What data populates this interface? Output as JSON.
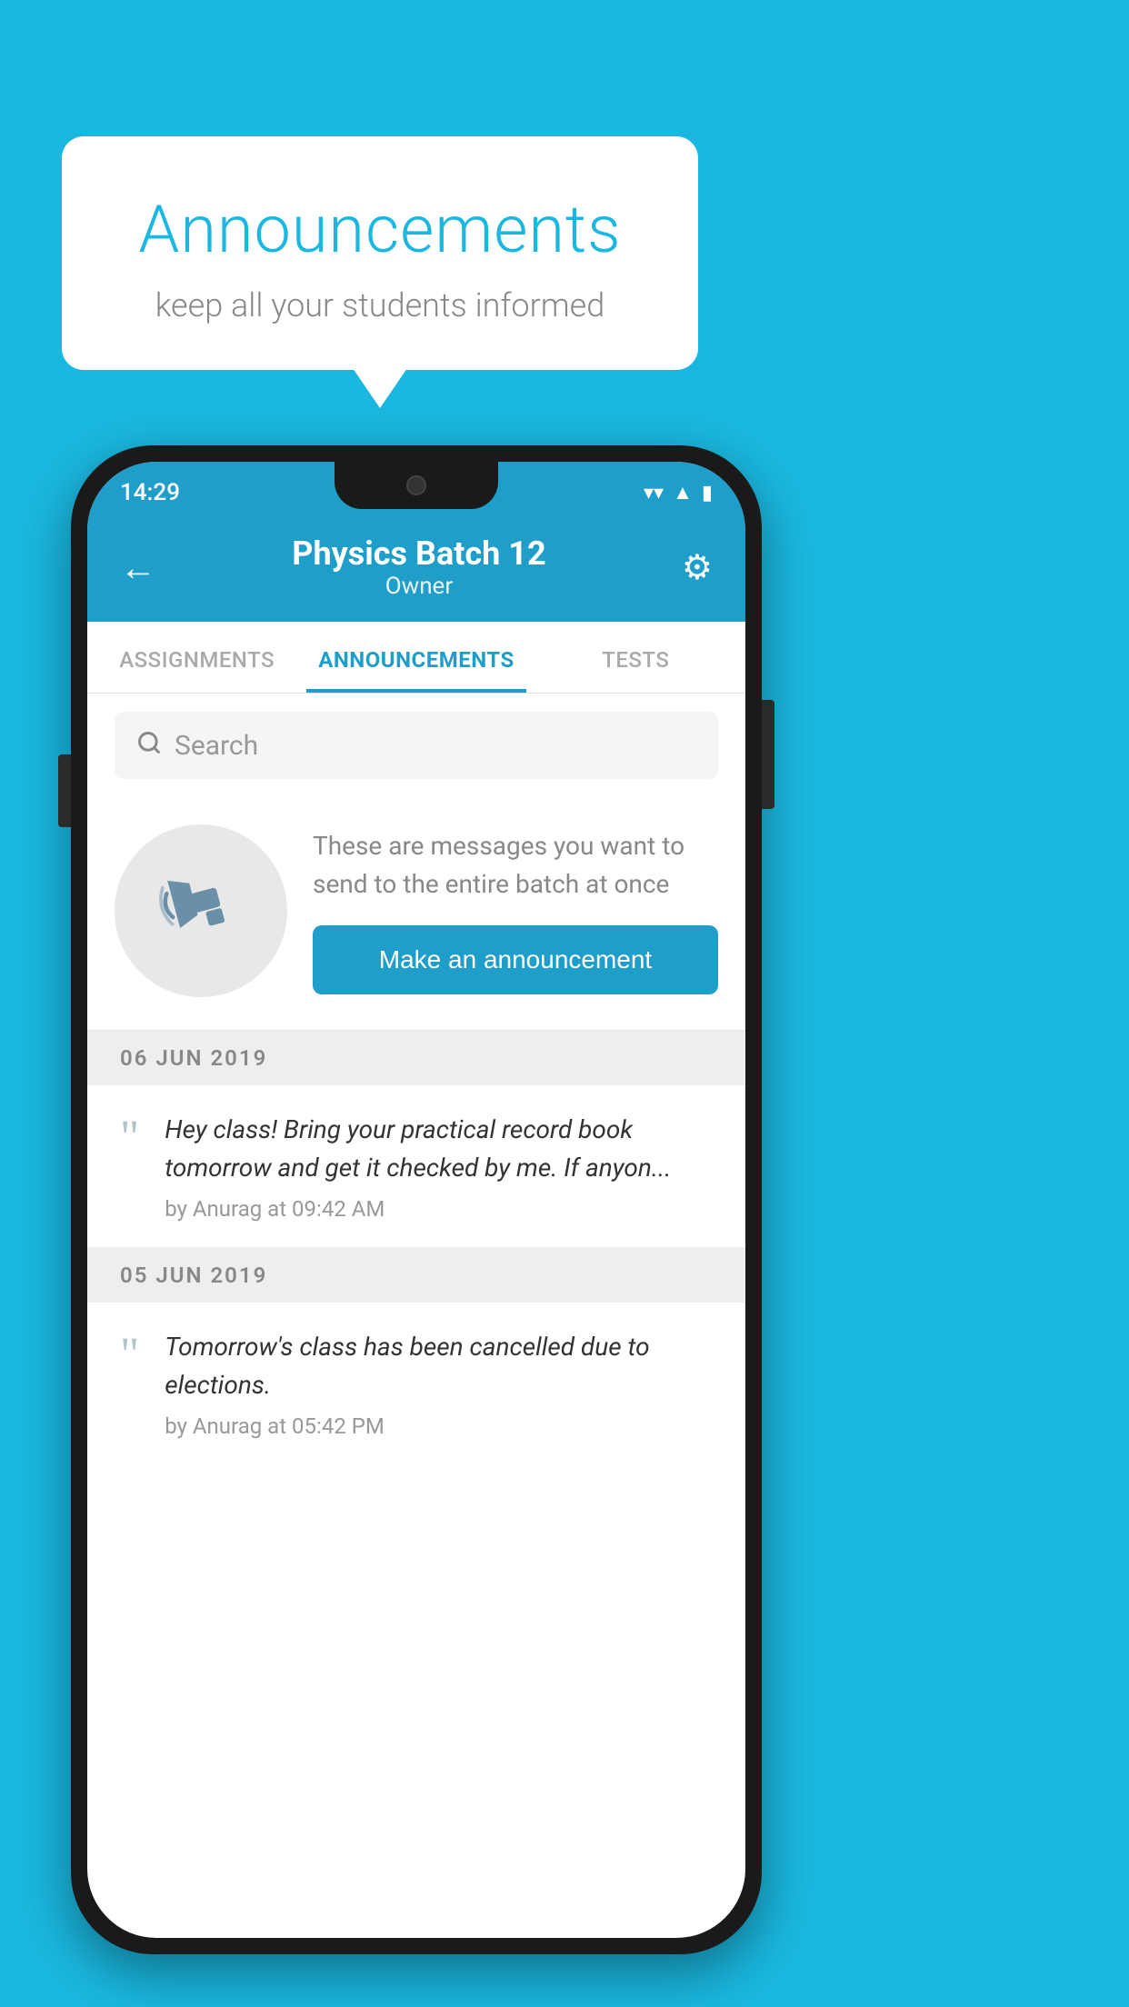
{
  "header": {
    "background_color": "#1ab8e0",
    "speech_bubble": {
      "title": "Announcements",
      "subtitle": "keep all your students informed"
    }
  },
  "phone": {
    "status_bar": {
      "time": "14:29",
      "wifi": "▼",
      "signal": "▲",
      "battery": "▮"
    },
    "app_header": {
      "back_icon": "←",
      "title": "Physics Batch 12",
      "subtitle": "Owner",
      "settings_icon": "⚙"
    },
    "tabs": [
      {
        "label": "ASSIGNMENTS",
        "active": false
      },
      {
        "label": "ANNOUNCEMENTS",
        "active": true
      },
      {
        "label": "TESTS",
        "active": false
      },
      {
        "label": "...",
        "active": false
      }
    ],
    "search": {
      "placeholder": "Search"
    },
    "announcement_promo": {
      "description": "These are messages you want to send to the entire batch at once",
      "button_label": "Make an announcement"
    },
    "announcements": [
      {
        "date": "06  JUN  2019",
        "text": "Hey class! Bring your practical record book tomorrow and get it checked by me. If anyon...",
        "meta": "by Anurag at 09:42 AM"
      },
      {
        "date": "05  JUN  2019",
        "text": "Tomorrow's class has been cancelled due to elections.",
        "meta": "by Anurag at 05:42 PM"
      }
    ]
  }
}
